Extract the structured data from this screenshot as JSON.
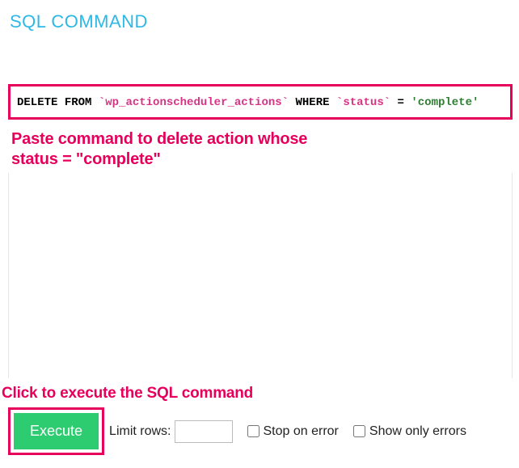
{
  "heading": "SQL COMMAND",
  "sql": {
    "kw_delete": "DELETE",
    "kw_from": "FROM",
    "table": "`wp_actionscheduler_actions`",
    "kw_where": "WHERE",
    "column": "`status`",
    "eq": "=",
    "value": "'complete'"
  },
  "annotations": {
    "paste": "Paste command to delete action whose\nstatus = \"complete\"",
    "execute": "Click to execute the SQL command"
  },
  "controls": {
    "execute_label": "Execute",
    "limit_label": "Limit rows:",
    "limit_value": "",
    "stop_on_error_label": "Stop on error",
    "show_only_errors_label": "Show only errors"
  }
}
